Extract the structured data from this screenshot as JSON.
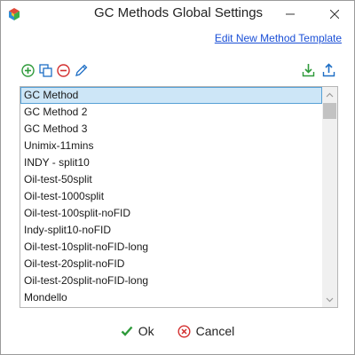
{
  "window": {
    "title": "GC Methods Global Settings"
  },
  "links": {
    "edit_template": "Edit New Method Template"
  },
  "toolbar": {
    "icons": [
      "add-icon",
      "copy-icon",
      "remove-icon",
      "edit-icon",
      "import-icon",
      "export-icon"
    ]
  },
  "methods": [
    "GC Method",
    "GC Method 2",
    "GC Method 3",
    "Unimix-11mins",
    "INDY - split10",
    "Oil-test-50split",
    "Oil-test-1000split",
    "Oil-test-100split-noFID",
    "Indy-split10-noFID",
    "Oil-test-10split-noFID-long",
    "Oil-test-20split-noFID",
    "Oil-test-20split-noFID-long",
    "Mondello"
  ],
  "selected_index": 0,
  "buttons": {
    "ok": "Ok",
    "cancel": "Cancel"
  },
  "colors": {
    "add": "#2e9a3a",
    "remove": "#d32f2f",
    "selection_bg": "#cde6f7",
    "selection_border": "#56a0d6",
    "link": "#1a4fd6"
  }
}
